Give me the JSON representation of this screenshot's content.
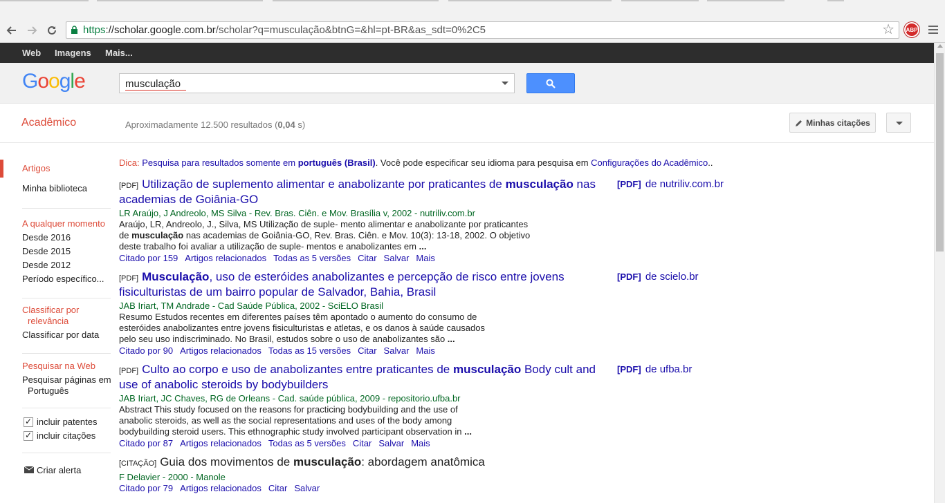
{
  "browser": {
    "url_scheme": "https",
    "url_host": "://scholar.google.com.br",
    "url_path": "/scholar?q=musculação&btnG=&hl=pt-BR&as_sdt=0%2C5",
    "abp_label": "ABP"
  },
  "gbar": {
    "web": "Web",
    "images": "Imagens",
    "more": "Mais..."
  },
  "search": {
    "query": "musculação"
  },
  "subheader": {
    "brand": "Acadêmico",
    "stats_prefix": "Aproximadamente 12.500 resultados (",
    "stats_time": "0,04",
    "stats_suffix": " s)",
    "my_citations": "Minhas citações"
  },
  "sidebar": {
    "articles": "Artigos",
    "library": "Minha biblioteca",
    "any_time": "A qualquer momento",
    "since_2016": "Desde 2016",
    "since_2015": "Desde 2015",
    "since_2012": "Desde 2012",
    "custom_range": "Período específico...",
    "sort_relevance_1": "Classificar por",
    "sort_relevance_2": "relevância",
    "sort_date": "Classificar por data",
    "search_web": "Pesquisar na Web",
    "search_pt_1": "Pesquisar páginas em",
    "search_pt_2": "Português",
    "include_patents": "incluir patentes",
    "include_citations": "incluir citações",
    "create_alert": "Criar alerta"
  },
  "tip": {
    "label": "Dica:",
    "link1_pre": "Pesquisa para resultados somente em ",
    "link1_bold": "português (Brasil)",
    "middle": ". Você pode especificar seu idioma para pesquisa em ",
    "link2": "Configurações do Acadêmico",
    "end": ".."
  },
  "results": [
    {
      "tag": "[PDF]",
      "title_a": "Utilização de suplemento alimentar e anabolizante por praticantes de ",
      "title_b": "musculação",
      "title_c": " nas academias de Goiânia-GO",
      "authors": "LR Araújo, J Andreolo, MS Silva - Rev. Bras. Ciên. e Mov. Brasília v, 2002 - nutriliv.com.br",
      "snippet_a": "Araújo, LR, Andreolo, J., Silva, MS Utilização de suple- mento alimentar e anabolizante por praticantes de ",
      "snippet_b": "musculação",
      "snippet_c": " nas academias de Goiânia-GO, Rev. Bras. Ciên. e Mov. 10(3): 13-18, 2002. O objetivo deste trabalho foi avaliar a utilização de suple- mentos e anabolizantes em ",
      "snippet_end": "...",
      "cited": "Citado por 159",
      "related": "Artigos relacionados",
      "versions": "Todas as 5 versões",
      "cite": "Citar",
      "save": "Salvar",
      "more": "Mais",
      "pdf_tag": "[PDF]",
      "pdf_src": "de nutriliv.com.br"
    },
    {
      "tag": "[PDF]",
      "title_a": "",
      "title_b": "Musculação",
      "title_c": ", uso de esteróides anabolizantes e percepção de risco entre jovens fisiculturistas de um bairro popular de Salvador, Bahia, Brasil",
      "authors": "JAB Iriart, TM Andrade - Cad Saúde Pública, 2002 - SciELO Brasil",
      "snippet_a": "Resumo Estudos recentes em diferentes países têm apontado o aumento do consumo de esteróides anabolizantes entre jovens fisiculturistas e atletas, e os danos à saúde causados pelo seu uso indiscriminado. No Brasil, estudos sobre o uso de anabolizantes são ",
      "snippet_b": "",
      "snippet_c": "",
      "snippet_end": "...",
      "cited": "Citado por 90",
      "related": "Artigos relacionados",
      "versions": "Todas as 15 versões",
      "cite": "Citar",
      "save": "Salvar",
      "more": "Mais",
      "pdf_tag": "[PDF]",
      "pdf_src": "de scielo.br"
    },
    {
      "tag": "[PDF]",
      "title_a": "Culto ao corpo e uso de anabolizantes entre praticantes de ",
      "title_b": "musculação",
      "title_c": " Body cult and use of anabolic steroids by bodybuilders",
      "authors": "JAB Iriart, JC Chaves, RG de Orleans - Cad. saúde pública, 2009 - repositorio.ufba.br",
      "snippet_a": "Abstract This study focused on the reasons for practicing bodybuilding and the use of anabolic steroids, as well as the social representations and uses of the body among bodybuilding steroid users. This ethnographic study involved participant observation in ",
      "snippet_b": "",
      "snippet_c": "",
      "snippet_end": "...",
      "cited": "Citado por 87",
      "related": "Artigos relacionados",
      "versions": "Todas as 5 versões",
      "cite": "Citar",
      "save": "Salvar",
      "more": "Mais",
      "pdf_tag": "[PDF]",
      "pdf_src": "de ufba.br"
    },
    {
      "tag": "[CITAÇÃO]",
      "title_a": "Guia dos movimentos de ",
      "title_b": "musculação",
      "title_c": ": abordagem anatômica",
      "authors": "F Delavier - 2000 - Manole",
      "cited": "Citado por 79",
      "related": "Artigos relacionados",
      "cite": "Citar",
      "save": "Salvar"
    }
  ]
}
